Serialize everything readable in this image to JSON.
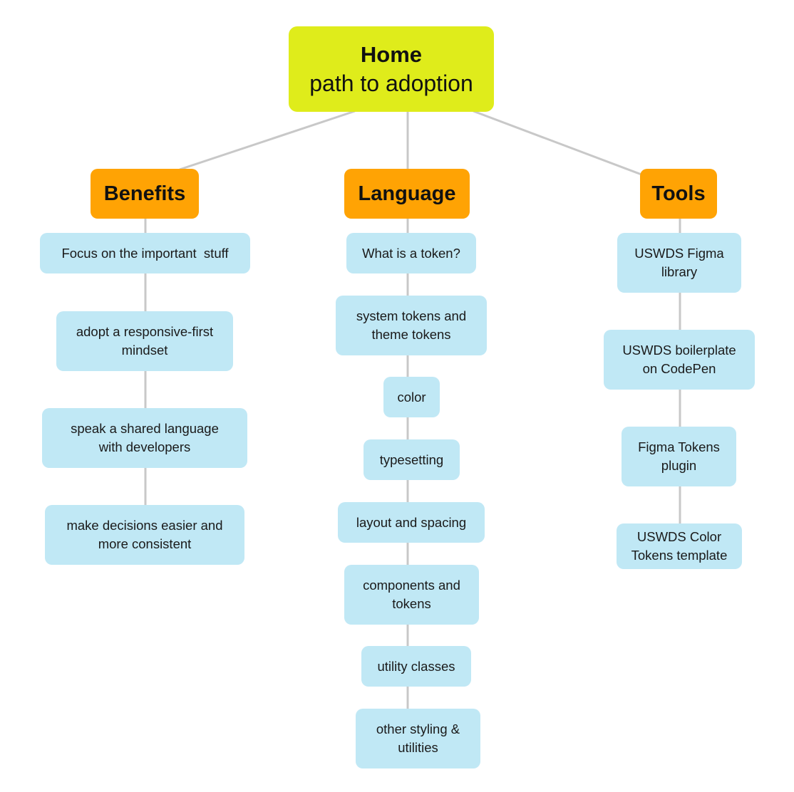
{
  "diagram": {
    "type": "mind-map",
    "colors": {
      "root": "#dfec1b",
      "category": "#ffa304",
      "leaf": "#c0e8f5",
      "connector": "#c8c8c8"
    },
    "root": {
      "title": "Home",
      "subtitle": "path to adoption"
    },
    "categories": [
      {
        "label": "Benefits",
        "items": [
          "Focus on the important  stuff",
          "adopt a responsive-first mindset",
          "speak a shared language with developers",
          "make decisions easier and more consistent"
        ]
      },
      {
        "label": "Language",
        "items": [
          "What is a token?",
          "system tokens and theme tokens",
          "color",
          "typesetting",
          "layout and spacing",
          "components and tokens",
          "utility classes",
          "other styling & utilities"
        ]
      },
      {
        "label": "Tools",
        "items": [
          "USWDS Figma library",
          "USWDS boilerplate on CodePen",
          "Figma Tokens plugin",
          "USWDS Color Tokens template"
        ]
      }
    ]
  }
}
